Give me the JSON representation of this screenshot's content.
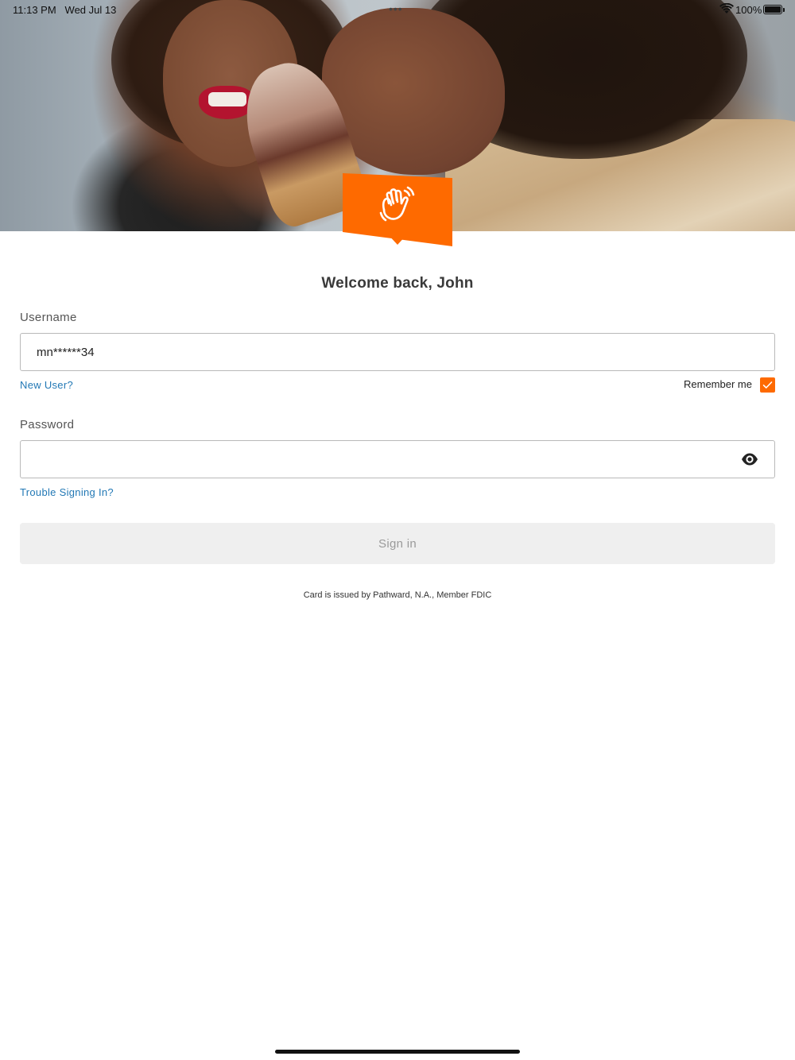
{
  "status_bar": {
    "time": "11:13 PM",
    "date": "Wed Jul 13",
    "battery": "100%"
  },
  "hero": {
    "image": "photo of couple sharing ice cream"
  },
  "badge": {
    "icon": "waving-hand-icon",
    "color": "#fe6a00"
  },
  "welcome": "Welcome back, John",
  "username": {
    "label": "Username",
    "value": "mn******34"
  },
  "links": {
    "new_user": "New User?",
    "trouble": "Trouble Signing In?"
  },
  "remember_me": {
    "label": "Remember me",
    "checked": true
  },
  "password": {
    "label": "Password",
    "value": "",
    "toggle_icon": "eye-icon"
  },
  "sign_in": {
    "label": "Sign in",
    "enabled": false
  },
  "disclaimer": "Card is issued by Pathward, N.A., Member FDIC",
  "colors": {
    "accent": "#fe6a00",
    "link": "#2278b5",
    "button_disabled_bg": "#efefef"
  }
}
